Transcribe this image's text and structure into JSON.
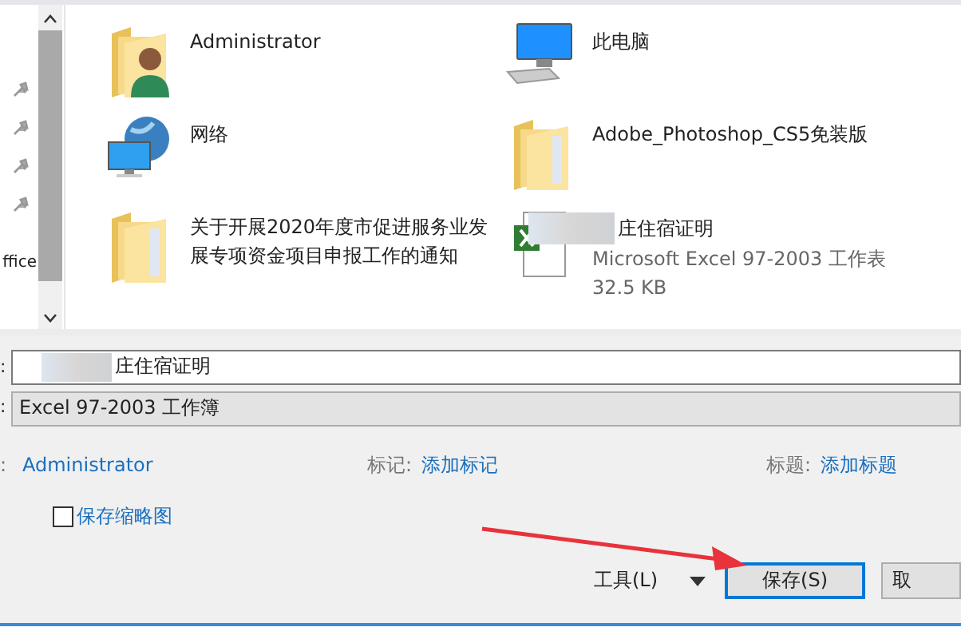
{
  "sidebar": {
    "items": [
      {
        "kind": "pin"
      },
      {
        "kind": "pin"
      },
      {
        "kind": "pin"
      },
      {
        "kind": "pin"
      },
      {
        "kind": "text",
        "label": "ffice"
      }
    ]
  },
  "files": [
    {
      "kind": "user-folder",
      "name": "Administrator"
    },
    {
      "kind": "computer",
      "name": "此电脑"
    },
    {
      "kind": "network",
      "name": "网络"
    },
    {
      "kind": "folder",
      "name": "Adobe_Photoshop_CS5免装版"
    },
    {
      "kind": "folder",
      "name": "关于开展2020年度市促进服务业发展专项资金项目申报工作的通知"
    },
    {
      "kind": "excel",
      "name": "庄住宿证明",
      "details": [
        "Microsoft Excel 97-2003 工作表",
        "32.5 KB"
      ],
      "blurred": true
    }
  ],
  "form": {
    "filename": {
      "label": ":",
      "value": "庄住宿证明",
      "blurred": true
    },
    "filetype": {
      "label": ":",
      "value": "Excel 97-2003 工作簿"
    }
  },
  "meta": [
    {
      "label": ":",
      "value": "Administrator"
    },
    {
      "label": "标记:",
      "value": "添加标记"
    },
    {
      "label": "标题:",
      "value": "添加标题"
    }
  ],
  "thumbnail": {
    "label": "保存缩略图",
    "checked": false
  },
  "buttons": [
    {
      "kind": "menu",
      "label": "工具(L)"
    },
    {
      "kind": "primary",
      "label": "保存(S)"
    },
    {
      "kind": "plain",
      "label": "取"
    }
  ],
  "annotation": {
    "kind": "arrow"
  }
}
